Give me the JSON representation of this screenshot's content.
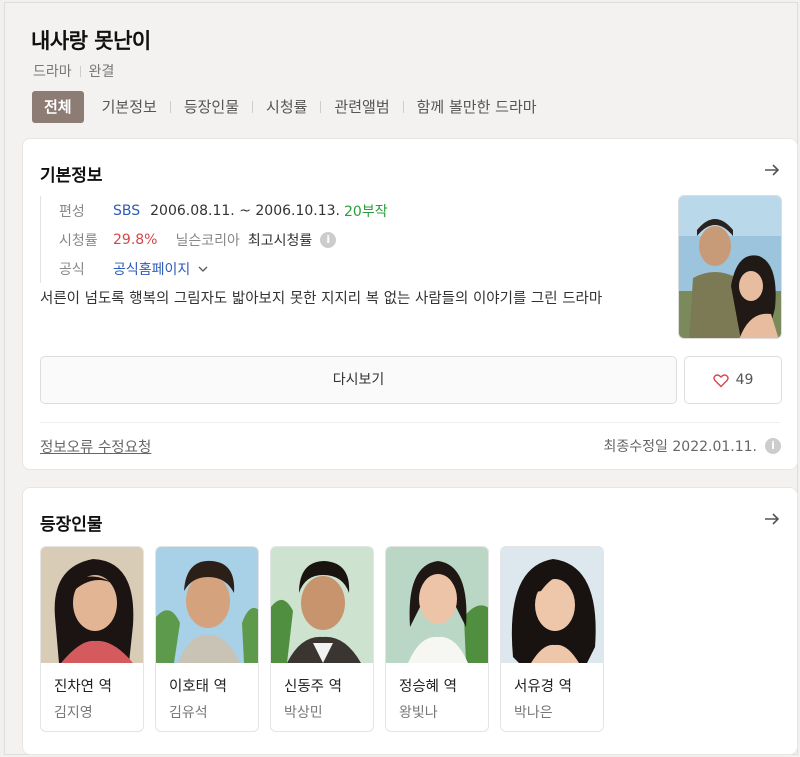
{
  "title": "내사랑 못난이",
  "subtitle": {
    "genre": "드라마",
    "status": "완결"
  },
  "tabs": [
    {
      "label": "전체"
    },
    {
      "label": "기본정보"
    },
    {
      "label": "등장인물"
    },
    {
      "label": "시청률"
    },
    {
      "label": "관련앨범"
    },
    {
      "label": "함께 볼만한 드라마"
    }
  ],
  "basic": {
    "title": "기본정보",
    "broadcast_label": "편성",
    "channel": "SBS",
    "dates": "2006.08.11. ~ 2006.10.13.",
    "episodes": "20부작",
    "rating_label": "시청률",
    "rating": "29.8%",
    "rating_source": "닐슨코리아",
    "rating_type": "최고시청률",
    "official_label": "공식",
    "official_link": "공식홈페이지",
    "description": "서른이 넘도록 행복의 그림자도 밟아보지 못한 지지리 복 없는 사람들의 이야기를 그린 드라마",
    "rewatch": "다시보기",
    "likes": "49",
    "report": "정보오류 수정요청",
    "updated": "최종수정일 2022.01.11."
  },
  "cast": {
    "title": "등장인물",
    "items": [
      {
        "role": "진차연 역",
        "actor": "김지영"
      },
      {
        "role": "이호태 역",
        "actor": "김유석"
      },
      {
        "role": "신동주 역",
        "actor": "박상민"
      },
      {
        "role": "정승혜 역",
        "actor": "왕빛나"
      },
      {
        "role": "서유경 역",
        "actor": "박나은"
      }
    ]
  },
  "colors": {
    "tab_active": "#8c7c73",
    "link": "#2e5bb8",
    "episodes": "#2a9d3c",
    "rating": "#d6464a"
  }
}
